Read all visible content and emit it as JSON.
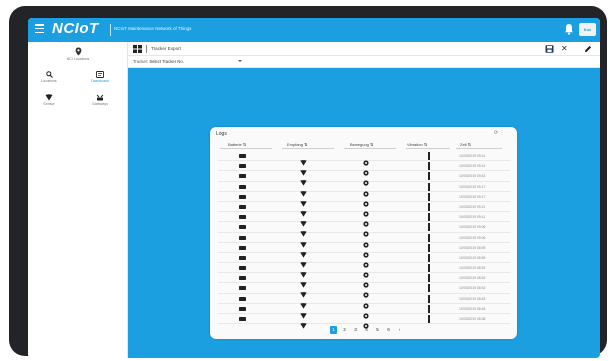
{
  "app": {
    "brand": "NCIoT",
    "subtitle": "NCIoT Maintenance Network of Things",
    "user_chip": "Kov"
  },
  "icons": {
    "menu": "hamburger-icon",
    "notifications": "bell-icon",
    "save": "save-icon",
    "close": "close-icon",
    "edit": "pencil-icon"
  },
  "colors": {
    "accent": "#1b9fe0",
    "frame": "#222427",
    "panel": "#fafafa"
  },
  "sidebar": {
    "top": {
      "label": "NCI Locations",
      "icon": "location-pin-icon"
    },
    "items": [
      {
        "label": "Locations",
        "icon": "search-icon",
        "active": false
      },
      {
        "label": "Dashboard",
        "icon": "dashboard-icon",
        "active": true
      },
      {
        "label": "Sensor",
        "icon": "sensor-icon",
        "active": false
      },
      {
        "label": "Gateways",
        "icon": "gateway-icon",
        "active": false
      }
    ]
  },
  "toolbar": {
    "title": "Tracker Export",
    "close_glyph": "✕"
  },
  "filter": {
    "label": "Tracker:",
    "value": "Select Tracker No."
  },
  "panel": {
    "title": "Logs",
    "tools": "⟳ ⋮",
    "columns": [
      "Batterie ⇅",
      "Empfang ⇅",
      "Bewegung ⇅",
      "Vibration ⇅",
      "Zeit ⇅"
    ],
    "rows": [
      {
        "date": "10/03/2019 09:41"
      },
      {
        "date": "10/03/2019 09:41"
      },
      {
        "date": "10/03/2019 09:42"
      },
      {
        "date": "10/03/2019 09:17"
      },
      {
        "date": "10/03/2019 09:17"
      },
      {
        "date": "10/03/2019 09:11"
      },
      {
        "date": "10/03/2019 09:11"
      },
      {
        "date": "10/03/2019 09:06"
      },
      {
        "date": "10/03/2019 09:06"
      },
      {
        "date": "10/03/2019 08:59"
      },
      {
        "date": "10/03/2019 08:59"
      },
      {
        "date": "10/03/2019 08:52"
      },
      {
        "date": "10/03/2019 08:52"
      },
      {
        "date": "10/03/2019 08:52"
      },
      {
        "date": "10/03/2019 08:45"
      },
      {
        "date": "10/03/2019 08:45"
      },
      {
        "date": "10/03/2019 08:38"
      }
    ],
    "pager": [
      "1",
      "2",
      "3",
      "4",
      "5",
      "6",
      "›"
    ],
    "current_page": "1"
  }
}
